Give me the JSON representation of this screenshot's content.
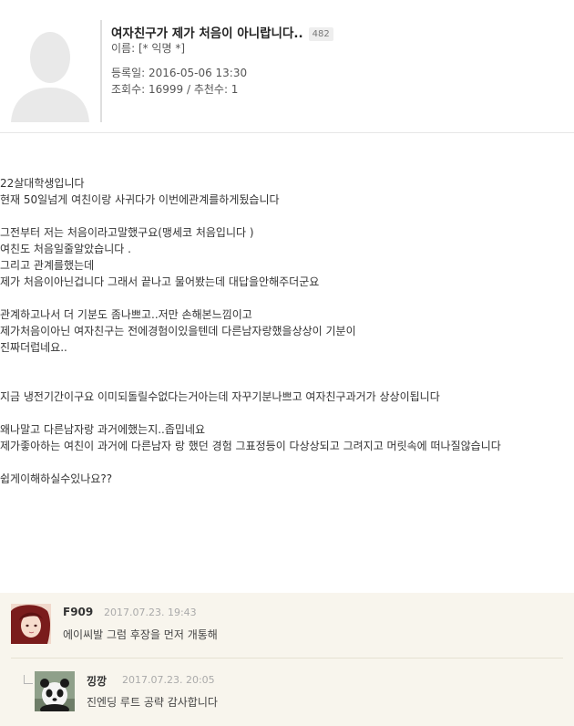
{
  "post": {
    "title": "여자친구가 제가 처음이 아니랍니다..",
    "count": "482",
    "author_label": "이름: [* 익명 *]",
    "date_label": "등록일: 2016-05-06 13:30",
    "stats_label": "조회수: 16999 / 추천수: 1"
  },
  "body": {
    "lines": [
      "22살대학생입니다",
      "현재 50일넘게 여친이랑 사귀다가 이번에관계를하게됬습니다",
      "",
      "그전부터 저는 처음이라고말했구요(맹세코 처음입니다 )",
      "여친도 처음일줄알았습니다 .",
      "그리고 관계를했는데",
      "제가 처음이아닌겁니다 그래서 끝나고 물어봤는데 대답을안해주더군요",
      "",
      "관계하고나서 더 기분도 좀나쁘고..저만 손해본느낌이고",
      "제가처음이아닌 여자친구는 전에경험이있을텐데 다른남자랑했을상상이 기분이",
      "진짜더럽네요..",
      "",
      "",
      "지금 냉전기간이구요 이미되돌릴수없다는거아는데 자꾸기분나쁘고 여자친구과거가 상상이됩니다",
      "",
      "왜나말고 다른남자랑 과거에했는지..좁밉네요",
      "제가좋아하는 여친이 과거에 다른남자 랑 했던 경험 그표정등이 다상상되고 그려지고 머릿속에 떠나질않습니다",
      "",
      "쉽게이해하실수있나요??"
    ]
  },
  "comments": [
    {
      "name": "F909",
      "date": "2017.07.23. 19:43",
      "text": "에이씨발 그럼 후장을 먼저 개통해"
    },
    {
      "name": "낑깡",
      "date": "2017.07.23. 20:05",
      "text": "진엔딩 루트 공략 감사합니다"
    }
  ]
}
